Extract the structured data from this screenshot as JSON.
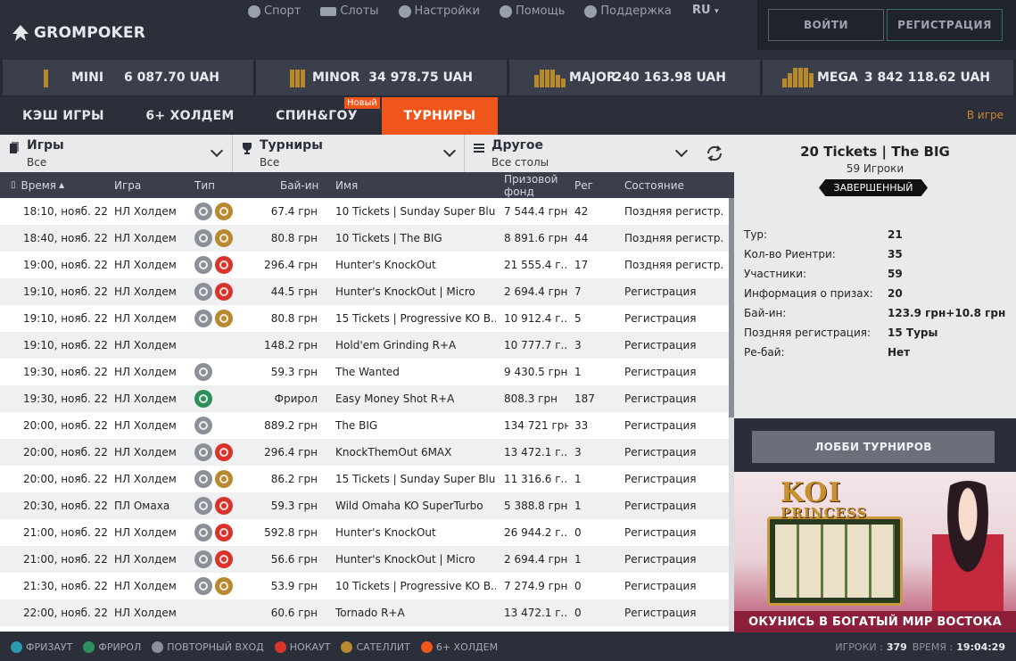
{
  "header": {
    "logo": "GROMPOKER",
    "nav": [
      {
        "label": "Спорт",
        "icon": "ball-icon"
      },
      {
        "label": "Слоты",
        "icon": "slot-icon"
      },
      {
        "label": "Настройки",
        "icon": "gear-icon"
      },
      {
        "label": "Помощь",
        "icon": "help-icon"
      },
      {
        "label": "Поддержка",
        "icon": "headset-icon"
      }
    ],
    "lang": "RU",
    "login": "ВОЙТИ",
    "register": "РЕГИСТРАЦИЯ"
  },
  "jackpots": [
    {
      "name": "MINI",
      "amount": "6 087.70 UAH",
      "bars": 1
    },
    {
      "name": "MINOR",
      "amount": "34 978.75 UAH",
      "bars": 2
    },
    {
      "name": "MAJOR",
      "amount": "240 163.98 UAH",
      "bars": 3
    },
    {
      "name": "MEGA",
      "amount": "3 842 118.62 UAH",
      "bars": 4
    }
  ],
  "tabs": [
    {
      "label": "КЭШ ИГРЫ"
    },
    {
      "label": "6+ ХОЛДЕМ"
    },
    {
      "label": "СПИН&ГОУ"
    },
    {
      "label": "ТУРНИРЫ"
    }
  ],
  "tab_badge": "Новый",
  "in_game": "В игре",
  "filters": [
    {
      "title": "Игры",
      "value": "Все"
    },
    {
      "title": "Турниры",
      "value": "Все"
    },
    {
      "title": "Другое",
      "value": "Все столы"
    }
  ],
  "columns": {
    "time": "Время",
    "game": "Игра",
    "type": "Тип",
    "buyin": "Бай-ин",
    "name": "Имя",
    "prize_line1": "Призовой",
    "prize_line2": "фонд",
    "reg": "Рег",
    "status": "Состояние"
  },
  "rows": [
    {
      "time": "18:10, нояб. 22",
      "game": "НЛ Холдем",
      "icons": [
        "rebuy",
        "sat"
      ],
      "buyin": "67.4 грн",
      "name": "10 Tickets | Sunday Super Blu...",
      "prize": "7 544.4 грн",
      "reg": "42",
      "status": "Поздняя регистр..."
    },
    {
      "time": "18:40, нояб. 22",
      "game": "НЛ Холдем",
      "icons": [
        "rebuy",
        "sat"
      ],
      "buyin": "80.8 грн",
      "name": "10 Tickets | The BIG",
      "prize": "8 891.6 грн",
      "reg": "44",
      "status": "Поздняя регистр..."
    },
    {
      "time": "19:00, нояб. 22",
      "game": "НЛ Холдем",
      "icons": [
        "rebuy",
        "ko"
      ],
      "buyin": "296.4 грн",
      "name": "Hunter's KnockOut",
      "prize": "21 555.4 г...",
      "reg": "17",
      "status": "Поздняя регистр..."
    },
    {
      "time": "19:10, нояб. 22",
      "game": "НЛ Холдем",
      "icons": [
        "rebuy",
        "ko"
      ],
      "buyin": "44.5 грн",
      "name": "Hunter's KnockOut | Micro",
      "prize": "2 694.4 грн",
      "reg": "7",
      "status": "Регистрация"
    },
    {
      "time": "19:10, нояб. 22",
      "game": "НЛ Холдем",
      "icons": [
        "rebuy",
        "sat"
      ],
      "buyin": "80.8 грн",
      "name": "15 Tickets | Progressive KO B...",
      "prize": "10 912.4 г...",
      "reg": "5",
      "status": "Регистрация"
    },
    {
      "time": "19:10, нояб. 22",
      "game": "НЛ Холдем",
      "icons": [],
      "buyin": "148.2 грн",
      "name": "Hold'em Grinding R+A",
      "prize": "10 777.7 г...",
      "reg": "3",
      "status": "Регистрация"
    },
    {
      "time": "19:30, нояб. 22",
      "game": "НЛ Холдем",
      "icons": [
        "rebuy"
      ],
      "buyin": "59.3 грн",
      "name": "The Wanted",
      "prize": "9 430.5 грн",
      "reg": "1",
      "status": "Регистрация"
    },
    {
      "time": "19:30, нояб. 22",
      "game": "НЛ Холдем",
      "icons": [
        "free"
      ],
      "buyin": "Фрирол",
      "name": "Easy Money Shot R+A",
      "prize": "808.3 грн",
      "reg": "187",
      "status": "Регистрация"
    },
    {
      "time": "20:00, нояб. 22",
      "game": "НЛ Холдем",
      "icons": [
        "rebuy"
      ],
      "buyin": "889.2 грн",
      "name": "The BIG",
      "prize": "134 721 грн",
      "reg": "33",
      "status": "Регистрация"
    },
    {
      "time": "20:00, нояб. 22",
      "game": "НЛ Холдем",
      "icons": [
        "rebuy",
        "ko"
      ],
      "buyin": "296.4 грн",
      "name": "KnockThemOut 6MAX",
      "prize": "13 472.1 г...",
      "reg": "3",
      "status": "Регистрация"
    },
    {
      "time": "20:00, нояб. 22",
      "game": "НЛ Холдем",
      "icons": [
        "rebuy",
        "sat"
      ],
      "buyin": "86.2 грн",
      "name": "15 Tickets | Sunday Super Blu...",
      "prize": "11 316.6 г...",
      "reg": "1",
      "status": "Регистрация"
    },
    {
      "time": "20:30, нояб. 22",
      "game": "ПЛ Омаха",
      "icons": [
        "rebuy",
        "ko"
      ],
      "buyin": "59.3 грн",
      "name": "Wild Omaha KO SuperTurbo",
      "prize": "5 388.8 грн",
      "reg": "1",
      "status": "Регистрация"
    },
    {
      "time": "21:00, нояб. 22",
      "game": "НЛ Холдем",
      "icons": [
        "rebuy",
        "ko"
      ],
      "buyin": "592.8 грн",
      "name": "Hunter's KnockOut",
      "prize": "26 944.2 г...",
      "reg": "0",
      "status": "Регистрация"
    },
    {
      "time": "21:00, нояб. 22",
      "game": "НЛ Холдем",
      "icons": [
        "rebuy",
        "ko"
      ],
      "buyin": "56.6 грн",
      "name": "Hunter's KnockOut | Micro",
      "prize": "2 694.4 грн",
      "reg": "1",
      "status": "Регистрация"
    },
    {
      "time": "21:30, нояб. 22",
      "game": "НЛ Холдем",
      "icons": [
        "rebuy",
        "sat"
      ],
      "buyin": "53.9 грн",
      "name": "10 Tickets | Progressive KO B...",
      "prize": "7 274.9 грн",
      "reg": "0",
      "status": "Регистрация"
    },
    {
      "time": "22:00, нояб. 22",
      "game": "НЛ Холдем",
      "icons": [],
      "buyin": "60.6 грн",
      "name": "Tornado R+A",
      "prize": "13 472.1 г...",
      "reg": "0",
      "status": "Регистрация"
    }
  ],
  "details": {
    "title": "20 Tickets | The BIG",
    "players": "59 Игроки",
    "status": "ЗАВЕРШЕННЫЙ",
    "info": [
      {
        "k": "Тур:",
        "v": "21"
      },
      {
        "k": "Кол-во Риентри:",
        "v": "35"
      },
      {
        "k": "Участники:",
        "v": "59"
      },
      {
        "k": "Информация о призах:",
        "v": "20"
      },
      {
        "k": "Бай-ин:",
        "v": "123.9 грн+10.8 грн"
      },
      {
        "k": "Поздняя регистрация:",
        "v": "15 Туры"
      },
      {
        "k": "Ре-бай:",
        "v": "Нет"
      }
    ],
    "lobby_button": "ЛОББИ ТУРНИРОВ"
  },
  "banner": {
    "logo_line1": "KOI",
    "logo_line2": "PRINCESS",
    "caption": "ОКУНИСЬ В БОГАТЫЙ МИР ВОСТОКА"
  },
  "legend": [
    {
      "label": "ФРИЗАУТ",
      "color": "#2a9bb0"
    },
    {
      "label": "ФРИРОЛ",
      "color": "#2e8f5a"
    },
    {
      "label": "ПОВТОРНЫЙ ВХОД",
      "color": "#8b8f98"
    },
    {
      "label": "НОКАУТ",
      "color": "#d9342b"
    },
    {
      "label": "САТЕЛЛИТ",
      "color": "#b9892f"
    },
    {
      "label": "6+ ХОЛДЕМ",
      "color": "#f0561b"
    }
  ],
  "footer": {
    "players_label": "ИГРОКИ :",
    "players_value": "379",
    "time_label": "ВРЕМЯ :",
    "time_value": "19:04:29"
  }
}
